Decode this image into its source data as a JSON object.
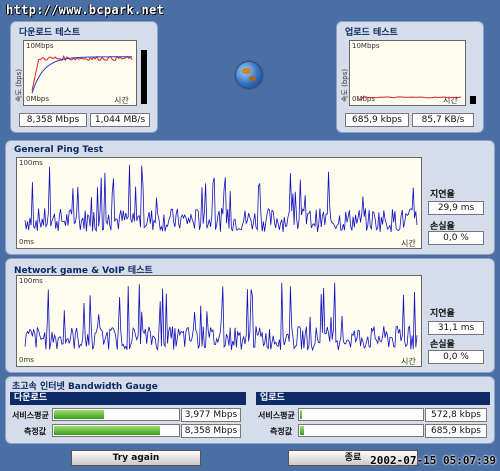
{
  "watermark": "http://www.bcpark.net",
  "download": {
    "title": "다운로드 테스트",
    "ytop": "10Mbps",
    "ybottom": "0Mbps",
    "yaxis": "속도 (bps)",
    "xaxis": "시간",
    "speed_mbps": "8,358 Mbps",
    "speed_mbs": "1,044 MB/s"
  },
  "upload": {
    "title": "업로드 테스트",
    "ytop": "10Mbps",
    "ybottom": "0Mbps",
    "yaxis": "속도 (bps)",
    "xaxis": "시간",
    "speed_kbps": "685,9 kbps",
    "speed_kbs": "85,7 KB/s"
  },
  "ping": {
    "title": "General Ping Test",
    "ytop": "100ms",
    "ybottom": "0ms",
    "xaxis": "시간",
    "latency_label": "지연율",
    "latency_value": "29,9 ms",
    "loss_label": "손실율",
    "loss_value": "0,0 %"
  },
  "game": {
    "title": "Network game & VoIP 테스트",
    "ytop": "100ms",
    "ybottom": "0ms",
    "xaxis": "시간",
    "latency_label": "지연율",
    "latency_value": "31,1 ms",
    "loss_label": "손실율",
    "loss_value": "0,0 %"
  },
  "gauge": {
    "title": "초고속 인터넷 Bandwidth Gauge",
    "download_section": "다운로드",
    "upload_section": "업로드",
    "avg_label": "서비스평균",
    "measured_label": "측정값",
    "dl_avg_value": "3,977 Mbps",
    "dl_measured_value": "8,358 Mbps",
    "ul_avg_value": "572,8 kbps",
    "ul_measured_value": "685,9 kbps",
    "dl_avg_fill": 0.4,
    "dl_measured_fill": 0.84,
    "ul_avg_fill": 0.02,
    "ul_measured_fill": 0.03
  },
  "buttons": {
    "try_again": "Try again",
    "close": "종료"
  },
  "timestamp": "2002-07-15 05:07:39",
  "colors": {
    "download_line": "#e02020",
    "download_avg": "#2040d0",
    "upload_line": "#d02030",
    "ping_line": "#1010c0"
  }
}
